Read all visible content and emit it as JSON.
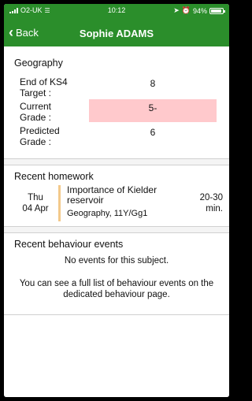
{
  "status_bar": {
    "carrier": "O2-UK",
    "time": "10:12",
    "battery": "94%"
  },
  "nav": {
    "back_label": "Back",
    "title": "Sophie ADAMS"
  },
  "subject": {
    "name": "Geography",
    "grades": [
      {
        "label": "End of KS4 Target :",
        "value": "8",
        "highlight": false
      },
      {
        "label": "Current Grade :",
        "value": "5-",
        "highlight": true
      },
      {
        "label": "Predicted Grade :",
        "value": "6",
        "highlight": false
      }
    ]
  },
  "homework": {
    "title": "Recent homework",
    "items": [
      {
        "day": "Thu",
        "date": "04 Apr",
        "title": "Importance of Kielder reservoir",
        "subject": "Geography, 11Y/Gg1",
        "duration": "20-30 min."
      }
    ]
  },
  "behaviour": {
    "title": "Recent behaviour events",
    "empty_text": "No events for this subject.",
    "info_text": "You can see a full list of behaviour events on the dedicated behaviour page."
  },
  "colors": {
    "nav_bg": "#2b8e2b",
    "highlight": "#ffc9cc",
    "homework_bar": "#f3c98b"
  }
}
